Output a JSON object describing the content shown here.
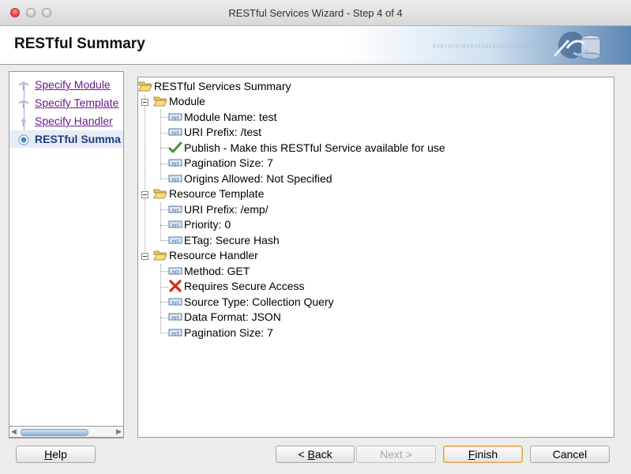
{
  "window": {
    "title": "RESTful Services Wizard - Step 4 of 4"
  },
  "banner": {
    "title": "RESTful Summary",
    "binary_text": "0101010101010101010101010101"
  },
  "steps": [
    {
      "label": "Specify Module",
      "state": "visited"
    },
    {
      "label": "Specify Template",
      "state": "visited"
    },
    {
      "label": "Specify Handler",
      "state": "visited"
    },
    {
      "label": "RESTful Summa",
      "state": "active"
    }
  ],
  "tree": {
    "root": "RESTful Services Summary",
    "module": {
      "label": "Module",
      "items": [
        {
          "text": "Module Name: test",
          "icon": "field-icon"
        },
        {
          "text": "URI Prefix: /test",
          "icon": "field-icon"
        },
        {
          "text": "Publish - Make this RESTful Service available for use",
          "icon": "checkmark-icon"
        },
        {
          "text": "Pagination Size: 7",
          "icon": "field-icon"
        },
        {
          "text": "Origins Allowed: Not Specified",
          "icon": "field-icon"
        }
      ]
    },
    "template": {
      "label": "Resource Template",
      "items": [
        {
          "text": "URI Prefix: /emp/",
          "icon": "field-icon"
        },
        {
          "text": "Priority: 0",
          "icon": "field-icon"
        },
        {
          "text": "ETag: Secure Hash",
          "icon": "field-icon"
        }
      ]
    },
    "handler": {
      "label": "Resource Handler",
      "items": [
        {
          "text": "Method: GET",
          "icon": "field-icon"
        },
        {
          "text": "Requires Secure Access",
          "icon": "cross-icon"
        },
        {
          "text": "Source Type: Collection Query",
          "icon": "field-icon"
        },
        {
          "text": "Data Format: JSON",
          "icon": "field-icon"
        },
        {
          "text": "Pagination Size: 7",
          "icon": "field-icon"
        }
      ]
    }
  },
  "buttons": {
    "help": {
      "mnemonic": "H",
      "rest": "elp"
    },
    "back": {
      "prefix": "< ",
      "mnemonic": "B",
      "rest": "ack"
    },
    "next": {
      "label": "Next >"
    },
    "finish": {
      "mnemonic": "F",
      "rest": "inish"
    },
    "cancel": {
      "label": "Cancel"
    }
  },
  "colors": {
    "link": "#6a1b8a",
    "active_step": "#1f3c88",
    "check": "#3a9a2a",
    "cross": "#d6281c",
    "default_button_border": "#e0a045"
  }
}
